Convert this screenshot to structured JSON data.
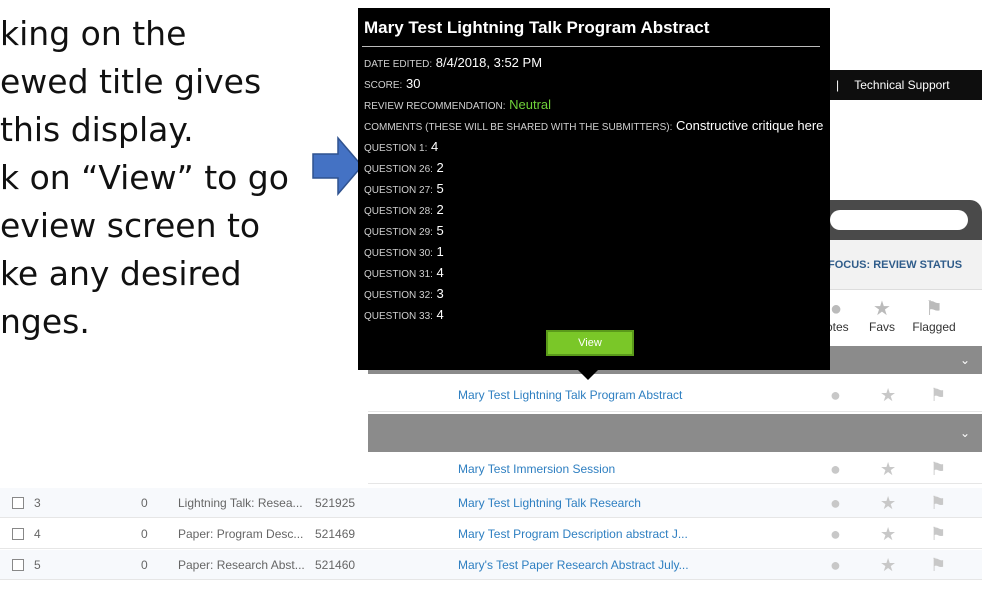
{
  "slide": {
    "lines": [
      "king on the",
      "ewed title gives",
      " this display.",
      "k on “View” to go",
      "eview screen to",
      "ke any desired",
      "nges."
    ]
  },
  "app": {
    "top_bar": {
      "separator": "|",
      "technical_support": "Technical Support"
    },
    "focus_label": "FOCUS: REVIEW STATUS",
    "column_icons": [
      {
        "label": "Notes",
        "display_label": "lotes",
        "icon": "speech-bubble-icon"
      },
      {
        "label": "Favs",
        "icon": "star-icon"
      },
      {
        "label": "Flagged",
        "icon": "flag-icon"
      }
    ],
    "rows": [
      {
        "num": "",
        "score": "",
        "type": "",
        "id": "",
        "title": "Mary Test Lightning Talk Program Abstract"
      },
      {
        "num": "",
        "score": "",
        "type": "",
        "id": "",
        "title": "Mary Test Immersion Session"
      },
      {
        "num": "3",
        "score": "0",
        "type": "Lightning Talk: Resea...",
        "id": "521925",
        "title": "Mary Test Lightning Talk Research"
      },
      {
        "num": "4",
        "score": "0",
        "type": "Paper: Program Desc...",
        "id": "521469",
        "title": "Mary Test Program Description abstract J..."
      },
      {
        "num": "5",
        "score": "0",
        "type": "Paper: Research Abst...",
        "id": "521460",
        "title": "Mary's Test Paper Research Abstract July..."
      }
    ]
  },
  "popup": {
    "title": "Mary Test Lightning Talk Program Abstract",
    "date_label": "DATE EDITED:",
    "date_value": "8/4/2018, 3:52 PM",
    "score_label": "SCORE:",
    "score_value": "30",
    "rec_label": "REVIEW RECOMMENDATION:",
    "rec_value": "Neutral",
    "comments_label": "COMMENTS (THESE WILL BE SHARED WITH THE SUBMITTERS):",
    "comments_value": "Constructive critique here",
    "questions": [
      {
        "label": "QUESTION 1:",
        "value": "4"
      },
      {
        "label": "QUESTION 26:",
        "value": "2"
      },
      {
        "label": "QUESTION 27:",
        "value": "5"
      },
      {
        "label": "QUESTION 28:",
        "value": "2"
      },
      {
        "label": "QUESTION 29:",
        "value": "5"
      },
      {
        "label": "QUESTION 30:",
        "value": "1"
      },
      {
        "label": "QUESTION 31:",
        "value": "4"
      },
      {
        "label": "QUESTION 32:",
        "value": "3"
      },
      {
        "label": "QUESTION 33:",
        "value": "4"
      }
    ],
    "view_label": "View"
  },
  "colors": {
    "popup_bg": "#000000",
    "neutral_green": "#6fd13a",
    "view_button": "#7ac728",
    "link_blue": "#2e7fc1",
    "arrow_blue": "#4472c4"
  }
}
